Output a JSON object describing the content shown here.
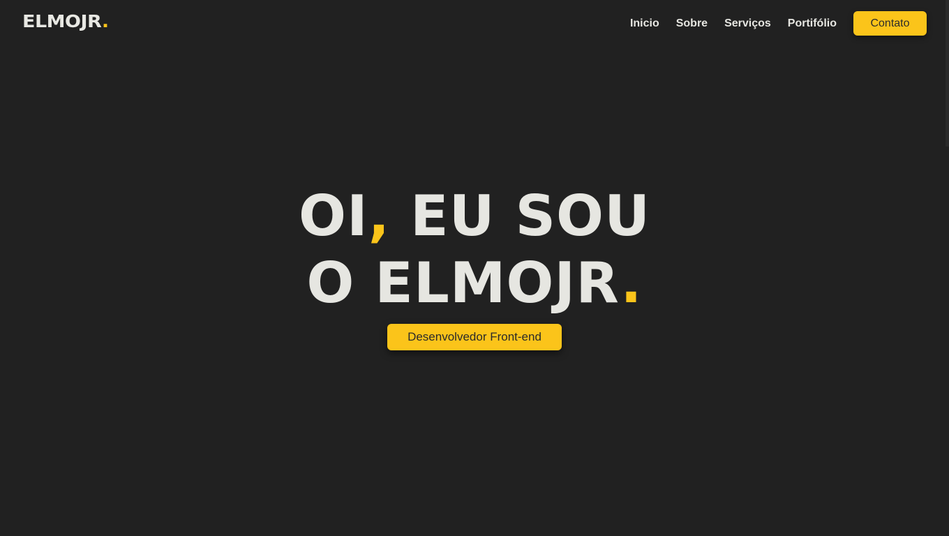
{
  "header": {
    "logo_text": "ELMOJR",
    "logo_dot": ".",
    "nav": {
      "items": [
        {
          "label": "Inicio"
        },
        {
          "label": "Sobre"
        },
        {
          "label": "Serviços"
        },
        {
          "label": "Portifólio"
        }
      ],
      "contact_label": "Contato"
    }
  },
  "hero": {
    "line1_a": "OI",
    "line1_comma": ",",
    "line1_b": " EU SOU",
    "line2_a": "O ELMOJR",
    "line2_dot": ".",
    "role": "Desenvolvedor Front-end"
  },
  "colors": {
    "background": "#212121",
    "accent": "#fbc41a",
    "text": "#e6e6e1"
  }
}
